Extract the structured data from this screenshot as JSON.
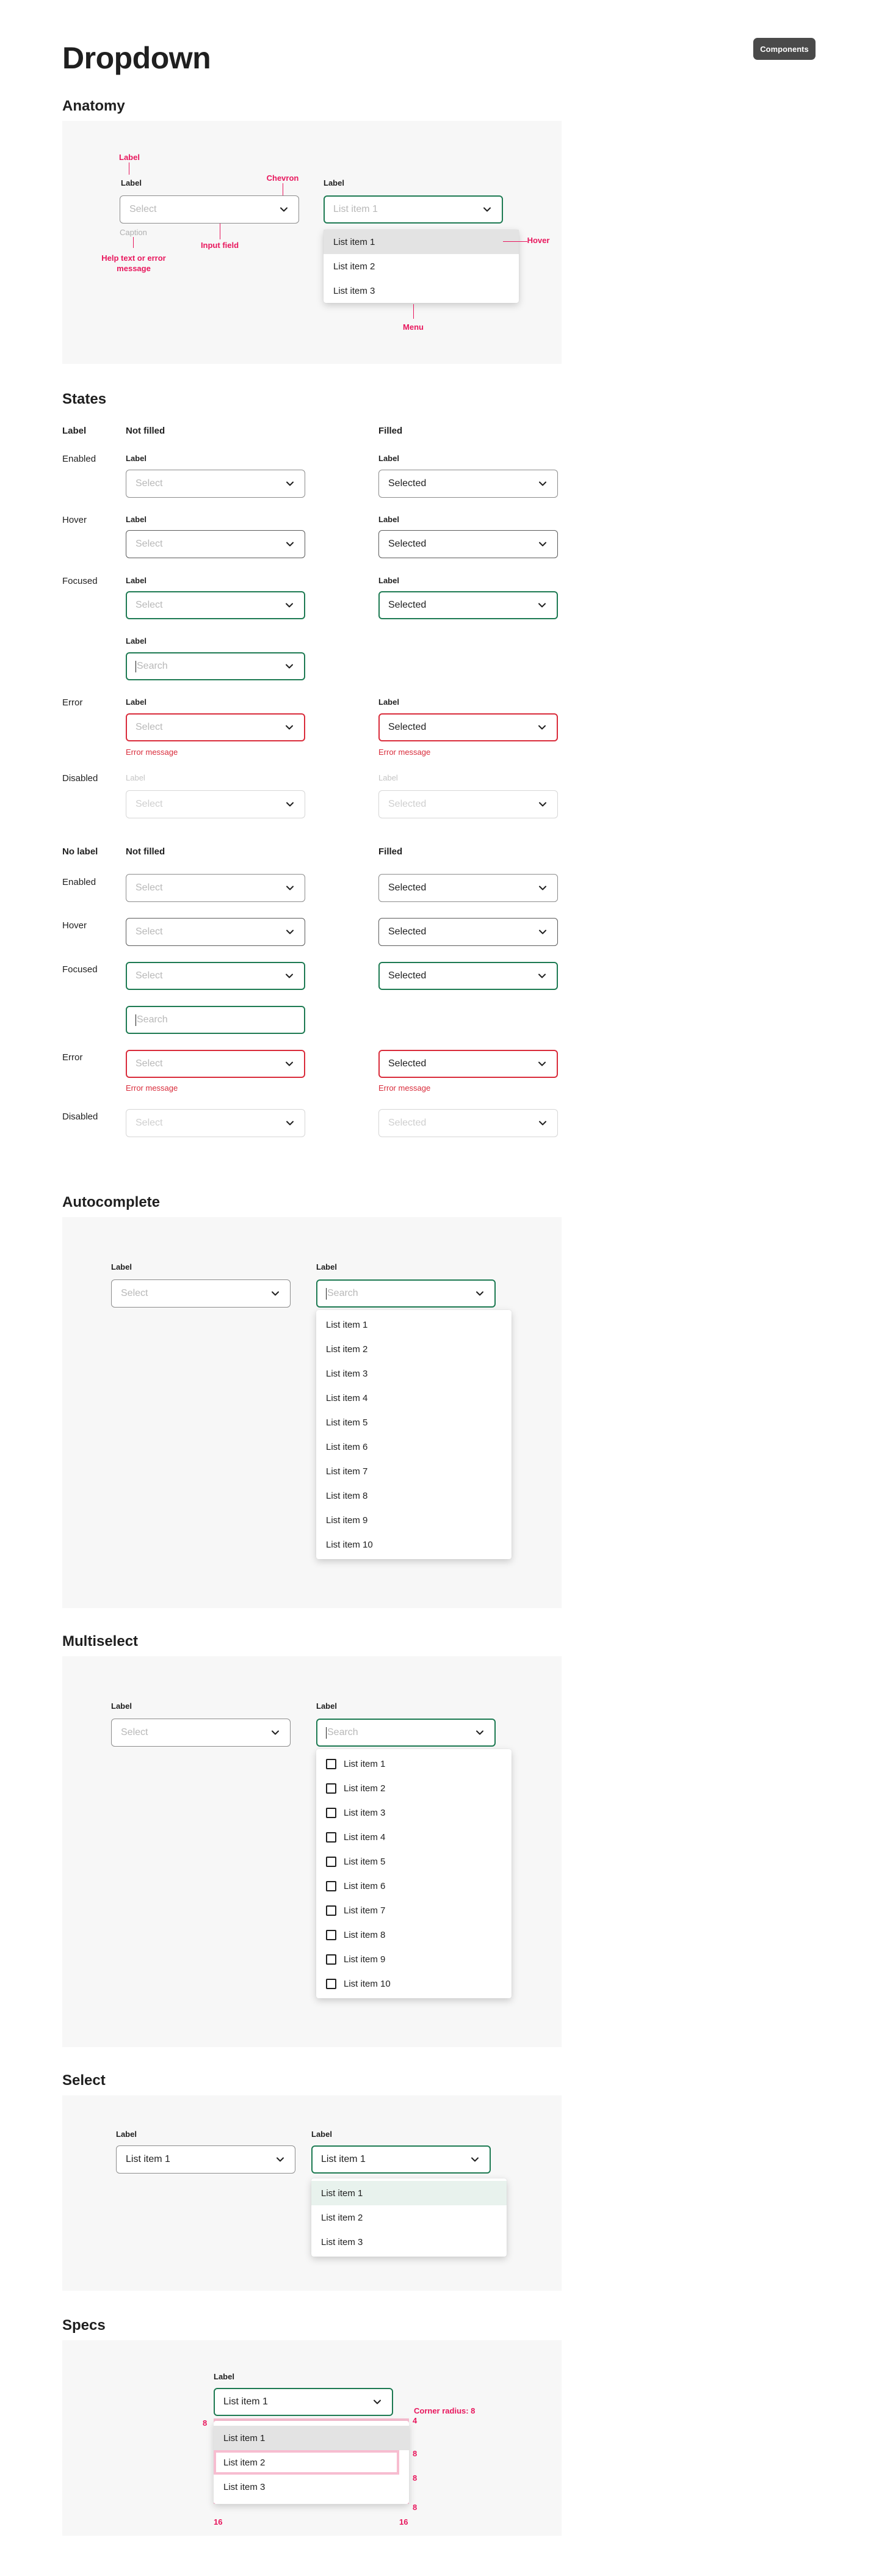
{
  "page": {
    "title": "Dropdown",
    "badge": "Components"
  },
  "anatomy": {
    "title": "Anatomy",
    "field_label": "Label",
    "placeholder": "Select",
    "caption": "Caption",
    "open_label": "Label",
    "open_value": "List item 1",
    "menu": [
      "List item 1",
      "List item 2",
      "List item 3"
    ],
    "annotations": {
      "label": "Label",
      "chevron": "Chevron",
      "input_field": "Input field",
      "help_text": "Help text or error message",
      "hover": "Hover",
      "menu": "Menu"
    }
  },
  "states": {
    "title": "States",
    "label_group": {
      "head": "Label",
      "not_filled": "Not filled",
      "filled": "Filled",
      "rows": {
        "enabled": "Enabled",
        "hover": "Hover",
        "focused": "Focused",
        "error": "Error",
        "disabled": "Disabled"
      }
    },
    "nolabel_group": {
      "head": "No label",
      "not_filled": "Not filled",
      "filled": "Filled",
      "rows": {
        "enabled": "Enabled",
        "hover": "Hover",
        "focused": "Focused",
        "error": "Error",
        "disabled": "Disabled"
      }
    },
    "field_label": "Label",
    "placeholder": "Select",
    "selected": "Selected",
    "search": "Search",
    "error_message": "Error message"
  },
  "autocomplete": {
    "title": "Autocomplete",
    "label": "Label",
    "placeholder": "Select",
    "search": "Search",
    "items": [
      "List item 1",
      "List item 2",
      "List item 3",
      "List item 4",
      "List item 5",
      "List item 6",
      "List item 7",
      "List item 8",
      "List item 9",
      "List item 10"
    ]
  },
  "multiselect": {
    "title": "Multiselect",
    "label": "Label",
    "placeholder": "Select",
    "search": "Search",
    "items": [
      "List item 1",
      "List item 2",
      "List item 3",
      "List item 4",
      "List item 5",
      "List item 6",
      "List item 7",
      "List item 8",
      "List item 9",
      "List item 10"
    ]
  },
  "select": {
    "title": "Select",
    "label": "Label",
    "value": "List item 1",
    "items": [
      "List item 1",
      "List item 2",
      "List item 3"
    ]
  },
  "specs": {
    "title": "Specs",
    "label": "Label",
    "value": "List item 1",
    "items": [
      "List item 1",
      "List item 2",
      "List item 3"
    ],
    "corner_radius": "Corner radius: 8",
    "dims": {
      "gap": "4",
      "left": "8",
      "row1": "8",
      "row2": "8",
      "bottom": "8",
      "pad_left": "16",
      "pad_right": "16"
    }
  },
  "colors": {
    "focus": "#1d7a52",
    "error": "#d92b3a",
    "annotation": "#e8175d",
    "badge": "#4a4a4a"
  }
}
